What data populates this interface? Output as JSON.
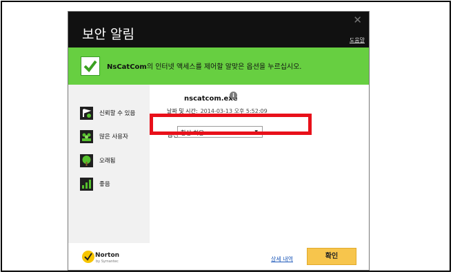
{
  "dialog": {
    "title": "보안 알림",
    "help_link": "도움말",
    "close_icon": "close-icon"
  },
  "banner": {
    "app_name": "NsCatCom",
    "message": "의 인터넷 액세스를 제어할 알맞은 옵션을 누르십시오.",
    "icon": "check-icon",
    "color": "#67cf41"
  },
  "sidebar": {
    "items": [
      {
        "label": "신뢰할 수 있음",
        "icon": "trust-icon"
      },
      {
        "label": "많은 사용자",
        "icon": "users-icon"
      },
      {
        "label": "오래됨",
        "icon": "age-icon"
      },
      {
        "label": "좋음",
        "icon": "signal-icon"
      }
    ]
  },
  "main": {
    "filename": "nscatcom.exe",
    "datetime_label": "날짜 및 시간:",
    "datetime_value": "2014-03-13 오후 5:52:09",
    "option_label": "옵션",
    "option_value": "항상 허용"
  },
  "footer": {
    "brand": "Norton",
    "brand_sub": "by Symantec",
    "details_link": "상세 내역",
    "ok_button": "확인"
  },
  "colors": {
    "highlight": "#e8101a",
    "button": "#f7c54c",
    "titlebar": "#111111"
  }
}
